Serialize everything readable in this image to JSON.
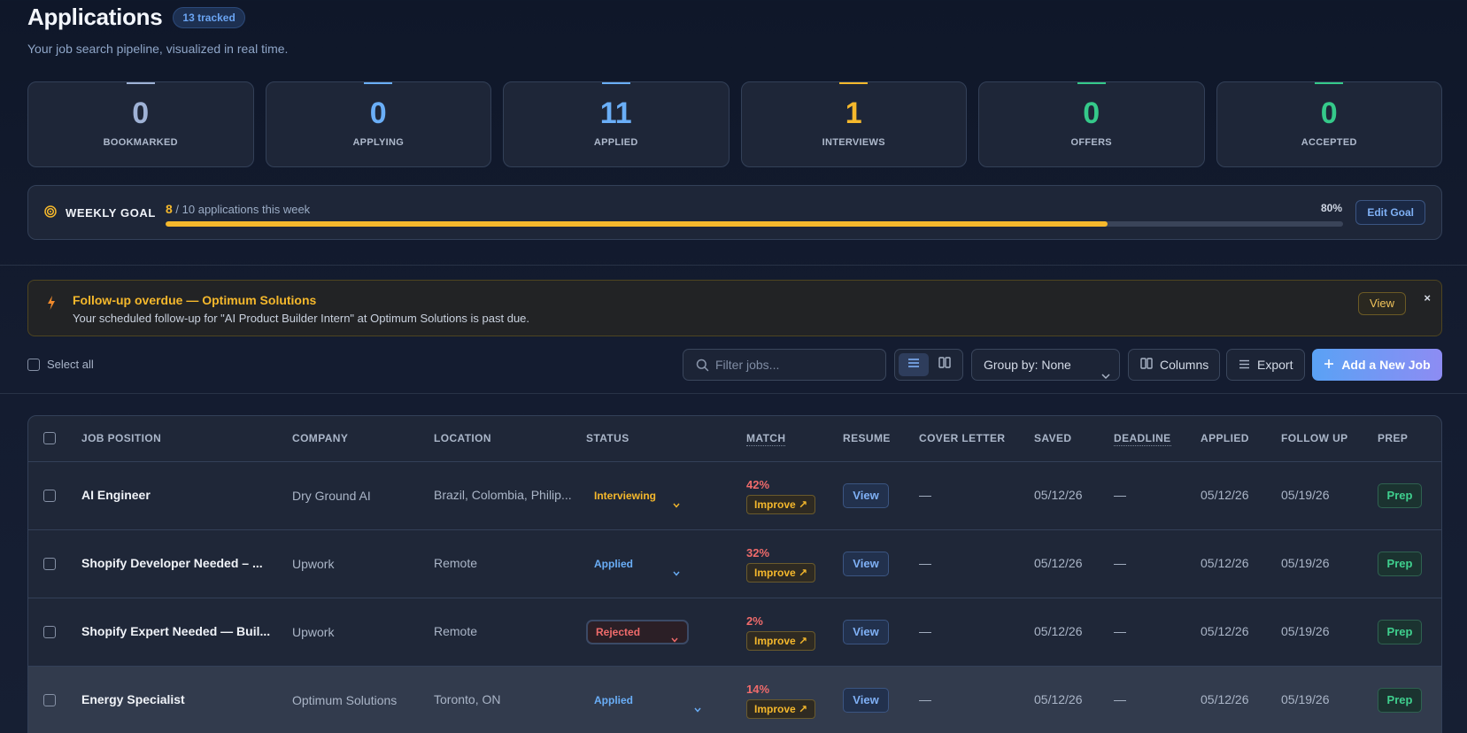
{
  "header": {
    "title": "Applications",
    "tracked_badge": "13 tracked",
    "subtitle": "Your job search pipeline, visualized in real time."
  },
  "stats": [
    {
      "value": "0",
      "label": "BOOKMARKED",
      "color": "#9fb2d6"
    },
    {
      "value": "0",
      "label": "APPLYING",
      "color": "#6aaef7"
    },
    {
      "value": "11",
      "label": "APPLIED",
      "color": "#6aaef7"
    },
    {
      "value": "1",
      "label": "INTERVIEWS",
      "color": "#f5b82c"
    },
    {
      "value": "0",
      "label": "OFFERS",
      "color": "#35c98a"
    },
    {
      "value": "0",
      "label": "ACCEPTED",
      "color": "#35c98a"
    }
  ],
  "goal": {
    "label": "WEEKLY GOAL",
    "count": "8",
    "text": "/ 10 applications this week",
    "percent_label": "80%",
    "progress_fraction": 0.8,
    "edit_label": "Edit Goal"
  },
  "alert": {
    "title": "Follow-up overdue — Optimum Solutions",
    "body": "Your scheduled follow-up for \"AI Product Builder Intern\" at Optimum Solutions is past due.",
    "view_label": "View",
    "close_label": "×"
  },
  "toolbar": {
    "select_all_label": "Select all",
    "filter_placeholder": "Filter jobs...",
    "group_by_label": "Group by: None",
    "columns_label": "Columns",
    "export_label": "Export",
    "add_job_label": "Add a New Job"
  },
  "table": {
    "headers": {
      "position": "JOB POSITION",
      "company": "COMPANY",
      "location": "LOCATION",
      "status": "STATUS",
      "match": "MATCH",
      "resume": "RESUME",
      "cover_letter": "COVER LETTER",
      "saved": "SAVED",
      "deadline": "DEADLINE",
      "applied": "APPLIED",
      "follow_up": "FOLLOW UP",
      "prep": "PREP"
    },
    "improve_label": "Improve ↗",
    "view_label": "View",
    "prep_label": "Prep",
    "rows": [
      {
        "position": "AI Engineer",
        "company": "Dry Ground AI",
        "location": "Brazil, Colombia, Philip...",
        "status": "Interviewing",
        "status_color": "#f5b82c",
        "match": "42%",
        "cover_letter": "—",
        "saved": "05/12/26",
        "deadline": "—",
        "applied": "05/12/26",
        "follow_up": "05/19/26"
      },
      {
        "position": "Shopify Developer Needed – ...",
        "company": "Upwork",
        "location": "Remote",
        "status": "Applied",
        "status_color": "#6aaef7",
        "match": "32%",
        "cover_letter": "—",
        "saved": "05/12/26",
        "deadline": "—",
        "applied": "05/12/26",
        "follow_up": "05/19/26"
      },
      {
        "position": "Shopify Expert Needed — Buil...",
        "company": "Upwork",
        "location": "Remote",
        "status": "Rejected",
        "status_color": "#f06b6b",
        "match": "2%",
        "cover_letter": "—",
        "saved": "05/12/26",
        "deadline": "—",
        "applied": "05/12/26",
        "follow_up": "05/19/26"
      },
      {
        "position": "Energy Specialist",
        "company": "Optimum Solutions",
        "location": "Toronto, ON",
        "status": "Applied",
        "status_color": "#6aaef7",
        "match": "14%",
        "cover_letter": "—",
        "saved": "05/12/26",
        "deadline": "—",
        "applied": "05/12/26",
        "follow_up": "05/19/26"
      }
    ]
  }
}
